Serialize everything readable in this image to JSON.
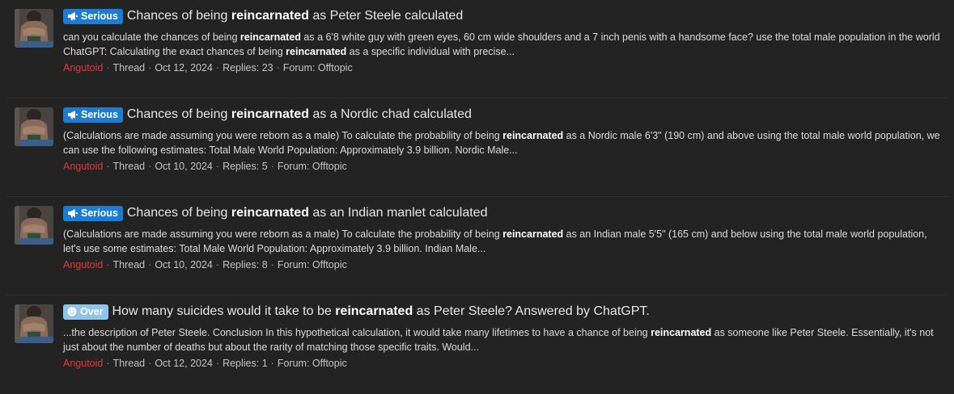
{
  "results": [
    {
      "prefix": "Serious",
      "prefix_style": "serious",
      "prefix_icon": "megaphone-icon",
      "title_before": "Chances of being ",
      "title_bold": "reincarnated",
      "title_after": " as Peter Steele calculated",
      "snippet_parts": [
        {
          "t": "can you calculate the chances of being ",
          "b": false
        },
        {
          "t": "reincarnated",
          "b": true
        },
        {
          "t": " as a 6'8 white guy with green eyes, 60 cm wide shoulders and a 7 inch penis with a handsome face? use the total male population in the world ChatGPT: Calculating the exact chances of being ",
          "b": false
        },
        {
          "t": "reincarnated",
          "b": true
        },
        {
          "t": " as a specific individual with precise...",
          "b": false
        }
      ],
      "author": "Angutoid",
      "type": "Thread",
      "date": "Oct 12, 2024",
      "replies": "Replies: 23",
      "forum": "Forum: Offtopic"
    },
    {
      "prefix": "Serious",
      "prefix_style": "serious",
      "prefix_icon": "megaphone-icon",
      "title_before": "Chances of being ",
      "title_bold": "reincarnated",
      "title_after": " as a Nordic chad calculated",
      "snippet_parts": [
        {
          "t": "(Calculations are made assuming you were reborn as a male) To calculate the probability of being ",
          "b": false
        },
        {
          "t": "reincarnated",
          "b": true
        },
        {
          "t": " as a Nordic male 6'3\" (190 cm) and above using the total male world population, we can use the following estimates: Total Male World Population: Approximately 3.9 billion. Nordic Male...",
          "b": false
        }
      ],
      "author": "Angutoid",
      "type": "Thread",
      "date": "Oct 10, 2024",
      "replies": "Replies: 5",
      "forum": "Forum: Offtopic"
    },
    {
      "prefix": "Serious",
      "prefix_style": "serious",
      "prefix_icon": "megaphone-icon",
      "title_before": "Chances of being ",
      "title_bold": "reincarnated",
      "title_after": " as an Indian manlet calculated",
      "snippet_parts": [
        {
          "t": "(Calculations are made assuming you were reborn as a male) To calculate the probability of being ",
          "b": false
        },
        {
          "t": "reincarnated",
          "b": true
        },
        {
          "t": " as an Indian male 5'5\" (165 cm) and below using the total male world population, let's use some estimates: Total Male World Population: Approximately 3.9 billion. Indian Male...",
          "b": false
        }
      ],
      "author": "Angutoid",
      "type": "Thread",
      "date": "Oct 10, 2024",
      "replies": "Replies: 8",
      "forum": "Forum: Offtopic"
    },
    {
      "prefix": "Over",
      "prefix_style": "over",
      "prefix_icon": "smiley-face-icon",
      "title_before": "How many suicides would it take to be ",
      "title_bold": "reincarnated",
      "title_after": " as Peter Steele? Answered by ChatGPT.",
      "snippet_parts": [
        {
          "t": "...the description of Peter Steele. Conclusion In this hypothetical calculation, it would take many lifetimes to have a chance of being ",
          "b": false
        },
        {
          "t": "reincarnated",
          "b": true
        },
        {
          "t": " as someone like Peter Steele. Essentially, it's not just about the number of deaths but about the rarity of matching those specific traits. Would...",
          "b": false
        }
      ],
      "author": "Angutoid",
      "type": "Thread",
      "date": "Oct 12, 2024",
      "replies": "Replies: 1",
      "forum": "Forum: Offtopic"
    }
  ],
  "colors": {
    "background": "#232323",
    "author": "#e03b3b",
    "serious_prefix": "#1e7bd2",
    "over_prefix": "#8fc4ea"
  }
}
